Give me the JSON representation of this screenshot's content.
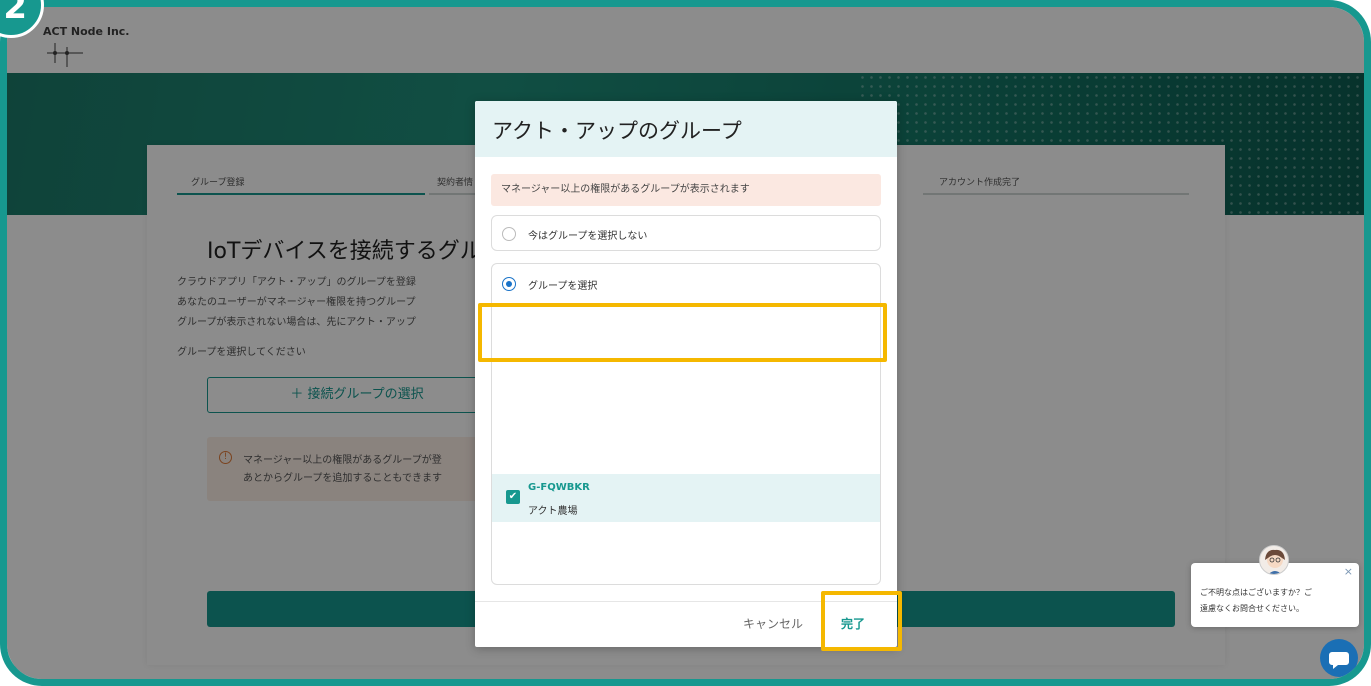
{
  "brand": {
    "name": "ACT Node Inc."
  },
  "step_badge": {
    "number": "2"
  },
  "steps": [
    "グループ登録",
    "契約者情",
    "アカウント作成完了"
  ],
  "main": {
    "title": "IoTデバイスを接続するグル",
    "desc_lines": [
      "クラウドアプリ「アクト・アップ」のグループを登録",
      "あなたのユーザーがマネージャー権限を持つグループ",
      "グループが表示されない場合は、先にアクト・アップ"
    ],
    "prompt": "グループを選択してください",
    "select_button": "＋ 接続グループの選択",
    "warning_lines": [
      "マネージャー以上の権限があるグループが登",
      "あとからグループを追加することもできます"
    ]
  },
  "modal": {
    "title": "アクト・アップのグループ",
    "notice": "マネージャー以上の権限があるグループが表示されます",
    "option_none": "今はグループを選択しない",
    "option_select": "グループを選択",
    "group": {
      "id": "G-FQWBKR",
      "name": "アクト農場",
      "checked": true
    },
    "cancel": "キャンセル",
    "done": "完了"
  },
  "chat": {
    "line1": "ご不明な点はございますか？ご",
    "line2": "遠慮なくお問合せください。",
    "close": "×"
  },
  "colors": {
    "accent": "#17988f",
    "highlight": "#f5b800",
    "chat": "#1a6fb5"
  },
  "icons": [
    "warning-icon",
    "check-icon",
    "close-icon",
    "chat-icon",
    "logo-mark-icon"
  ]
}
